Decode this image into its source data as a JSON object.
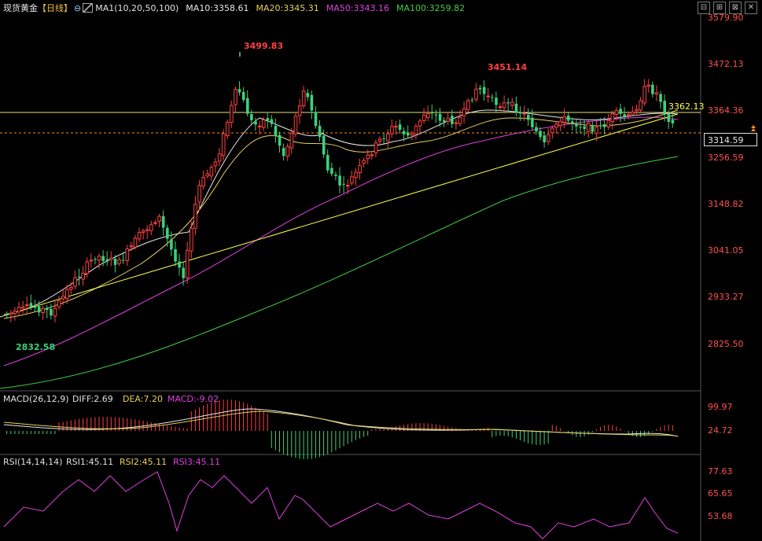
{
  "header": {
    "title": "现货黄金",
    "period": "【日线】",
    "ma_label": "MA1(10,20,50,100)",
    "ma10": "MA10:3358.61",
    "ma20": "MA20:3345.31",
    "ma50": "MA50:3343.16",
    "ma100": "MA100:3259.82"
  },
  "window_buttons": [
    "⊟",
    "⊞",
    "⊠",
    "✕"
  ],
  "main_axis": [
    "3579.90",
    "3472.13",
    "3364.36",
    "3256.59",
    "3148.82",
    "3041.05",
    "2933.27",
    "2825.50"
  ],
  "current_price": "3314.59",
  "annotations": {
    "high1": "3499.83",
    "high2": "3451.14",
    "low": "2832.58",
    "line_label": "3362.13"
  },
  "macd": {
    "label": "MACD(26,12,9)",
    "diff": "DIFF:2.69",
    "dea": "DEA:7.20",
    "macd": "MACD:-9.02",
    "axis": [
      "99.97",
      "24.72"
    ]
  },
  "rsi": {
    "label": "RSI(14,14,14)",
    "rsi1": "RSI1:45.11",
    "rsi2": "RSI2:45.11",
    "rsi3": "RSI3:45.11",
    "axis": [
      "77.63",
      "65.65",
      "53.68"
    ]
  },
  "colors": {
    "up": "#ff4040",
    "down": "#3ed07a",
    "ma10": "#e8e8e8",
    "ma20": "#e8d060",
    "ma50": "#e040e0",
    "ma100": "#40d040",
    "trend": "#ffff50",
    "axis_text": "#ff5050",
    "price_line": "#ff8c1a"
  }
}
